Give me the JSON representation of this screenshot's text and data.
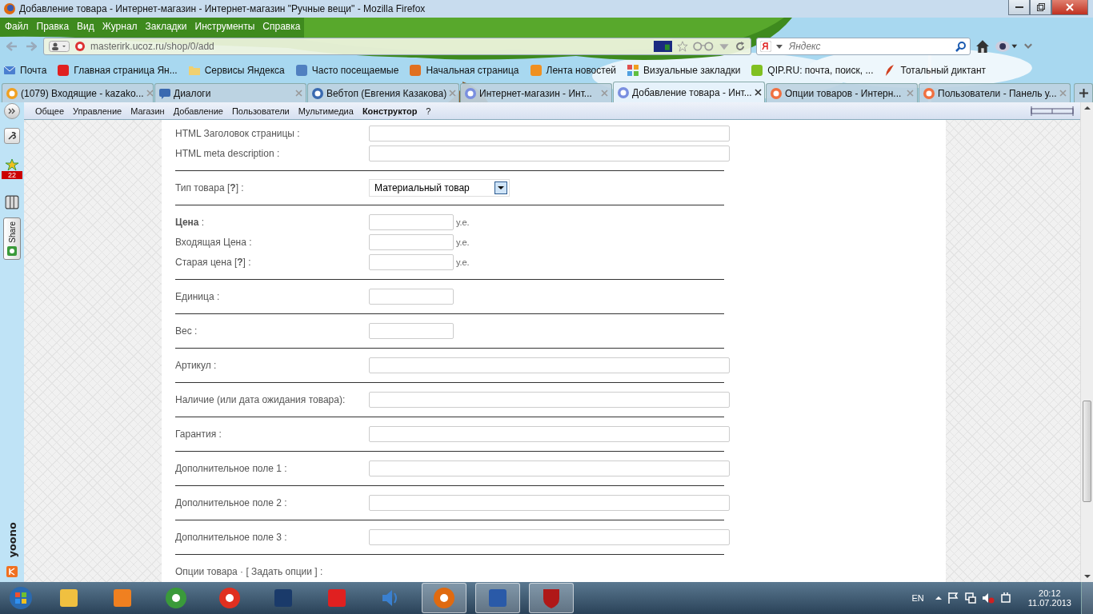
{
  "window": {
    "title": "Добавление товара - Интернет-магазин - Интернет-магазин \"Ручные вещи\" - Mozilla Firefox"
  },
  "menu": [
    "Файл",
    "Правка",
    "Вид",
    "Журнал",
    "Закладки",
    "Инструменты",
    "Справка"
  ],
  "address_bar": {
    "url": "masterirk.ucoz.ru/shop/0/add"
  },
  "search": {
    "placeholder": "Яндекс"
  },
  "bookmarks": [
    {
      "label": "Почта",
      "kind": "mail"
    },
    {
      "label": "Главная страница Ян...",
      "kind": "yandex"
    },
    {
      "label": "Сервисы Яндекса",
      "kind": "folder"
    },
    {
      "label": "Часто посещаемые",
      "kind": "search"
    },
    {
      "label": "Начальная страница",
      "kind": "firefox"
    },
    {
      "label": "Лента новостей",
      "kind": "rss"
    },
    {
      "label": "Визуальные закладки",
      "kind": "grid"
    },
    {
      "label": "QIP.RU: почта, поиск, ...",
      "kind": "qip"
    },
    {
      "label": "Тотальный диктант",
      "kind": "feather"
    }
  ],
  "tabs": [
    {
      "label": "(1079) Входящие - kazako...",
      "kind": "mail",
      "selected": false
    },
    {
      "label": "Диалоги",
      "kind": "chat",
      "selected": false
    },
    {
      "label": "Вебтоп (Евгения Казакова)",
      "kind": "webtop",
      "selected": false
    },
    {
      "label": "Интернет-магазин - Инт...",
      "kind": "ucoz",
      "selected": false
    },
    {
      "label": "Добавление товара - Инт...",
      "kind": "ucoz",
      "selected": true
    },
    {
      "label": "Опции товаров - Интерн...",
      "kind": "ucoz-admin",
      "selected": false
    },
    {
      "label": "Пользователи - Панель у...",
      "kind": "ucoz-admin",
      "selected": false
    }
  ],
  "admin_menu": [
    {
      "label": "Общее",
      "selected": false
    },
    {
      "label": "Управление",
      "selected": false
    },
    {
      "label": "Магазин",
      "selected": false
    },
    {
      "label": "Добавление",
      "selected": false
    },
    {
      "label": "Пользователи",
      "selected": false
    },
    {
      "label": "Мультимедиа",
      "selected": false
    },
    {
      "label": "Конструктор",
      "selected": true
    },
    {
      "label": "?",
      "selected": false
    }
  ],
  "sidebar": {
    "badge": "22",
    "share": "Share",
    "brand": "yoono"
  },
  "form": {
    "groups": [
      {
        "rows": [
          {
            "label": "HTML Заголовок страницы :",
            "kind": "wide"
          },
          {
            "label": "HTML meta description :",
            "kind": "wide"
          }
        ]
      },
      {
        "rows": [
          {
            "label": "Тип товара [**?**] :",
            "kind": "select",
            "value": "Материальный товар"
          }
        ]
      },
      {
        "rows": [
          {
            "label": "**Цена** :",
            "kind": "price",
            "unit": "у.е."
          },
          {
            "label": "Входящая Цена :",
            "kind": "price",
            "unit": "у.е."
          },
          {
            "label": "Старая цена [**?**] :",
            "kind": "price",
            "unit": "у.е."
          }
        ]
      },
      {
        "rows": [
          {
            "label": "Единица :",
            "kind": "short"
          }
        ]
      },
      {
        "rows": [
          {
            "label": "Вес :",
            "kind": "short"
          }
        ]
      },
      {
        "rows": [
          {
            "label": "Артикул :",
            "kind": "wide"
          }
        ]
      },
      {
        "rows": [
          {
            "label": "Наличие (или дата ожидания товара):",
            "kind": "wide"
          }
        ]
      },
      {
        "rows": [
          {
            "label": "Гарантия :",
            "kind": "wide"
          }
        ]
      },
      {
        "rows": [
          {
            "label": "Дополнительное поле 1 :",
            "kind": "wide"
          }
        ]
      },
      {
        "rows": [
          {
            "label": "Дополнительное поле 2 :",
            "kind": "wide"
          }
        ]
      },
      {
        "rows": [
          {
            "label": "Дополнительное поле 3 :",
            "kind": "wide"
          }
        ]
      }
    ],
    "options": {
      "before": "Опции товара · [ ",
      "link": "Задать опции",
      "after": " ] :"
    }
  },
  "taskbar": {
    "apps": [
      {
        "kind": "explorer",
        "selected": false
      },
      {
        "kind": "media",
        "selected": false
      },
      {
        "kind": "chrome",
        "selected": false
      },
      {
        "kind": "yandex-browser",
        "selected": false
      },
      {
        "kind": "photoshop",
        "selected": false
      },
      {
        "kind": "yandex",
        "selected": false
      },
      {
        "kind": "speaker",
        "selected": false
      },
      {
        "kind": "firefox",
        "selected": true
      },
      {
        "kind": "word",
        "selected": true
      },
      {
        "kind": "shield",
        "selected": true
      }
    ],
    "language": "EN",
    "time": "20:12",
    "date": "11.07.2013"
  }
}
